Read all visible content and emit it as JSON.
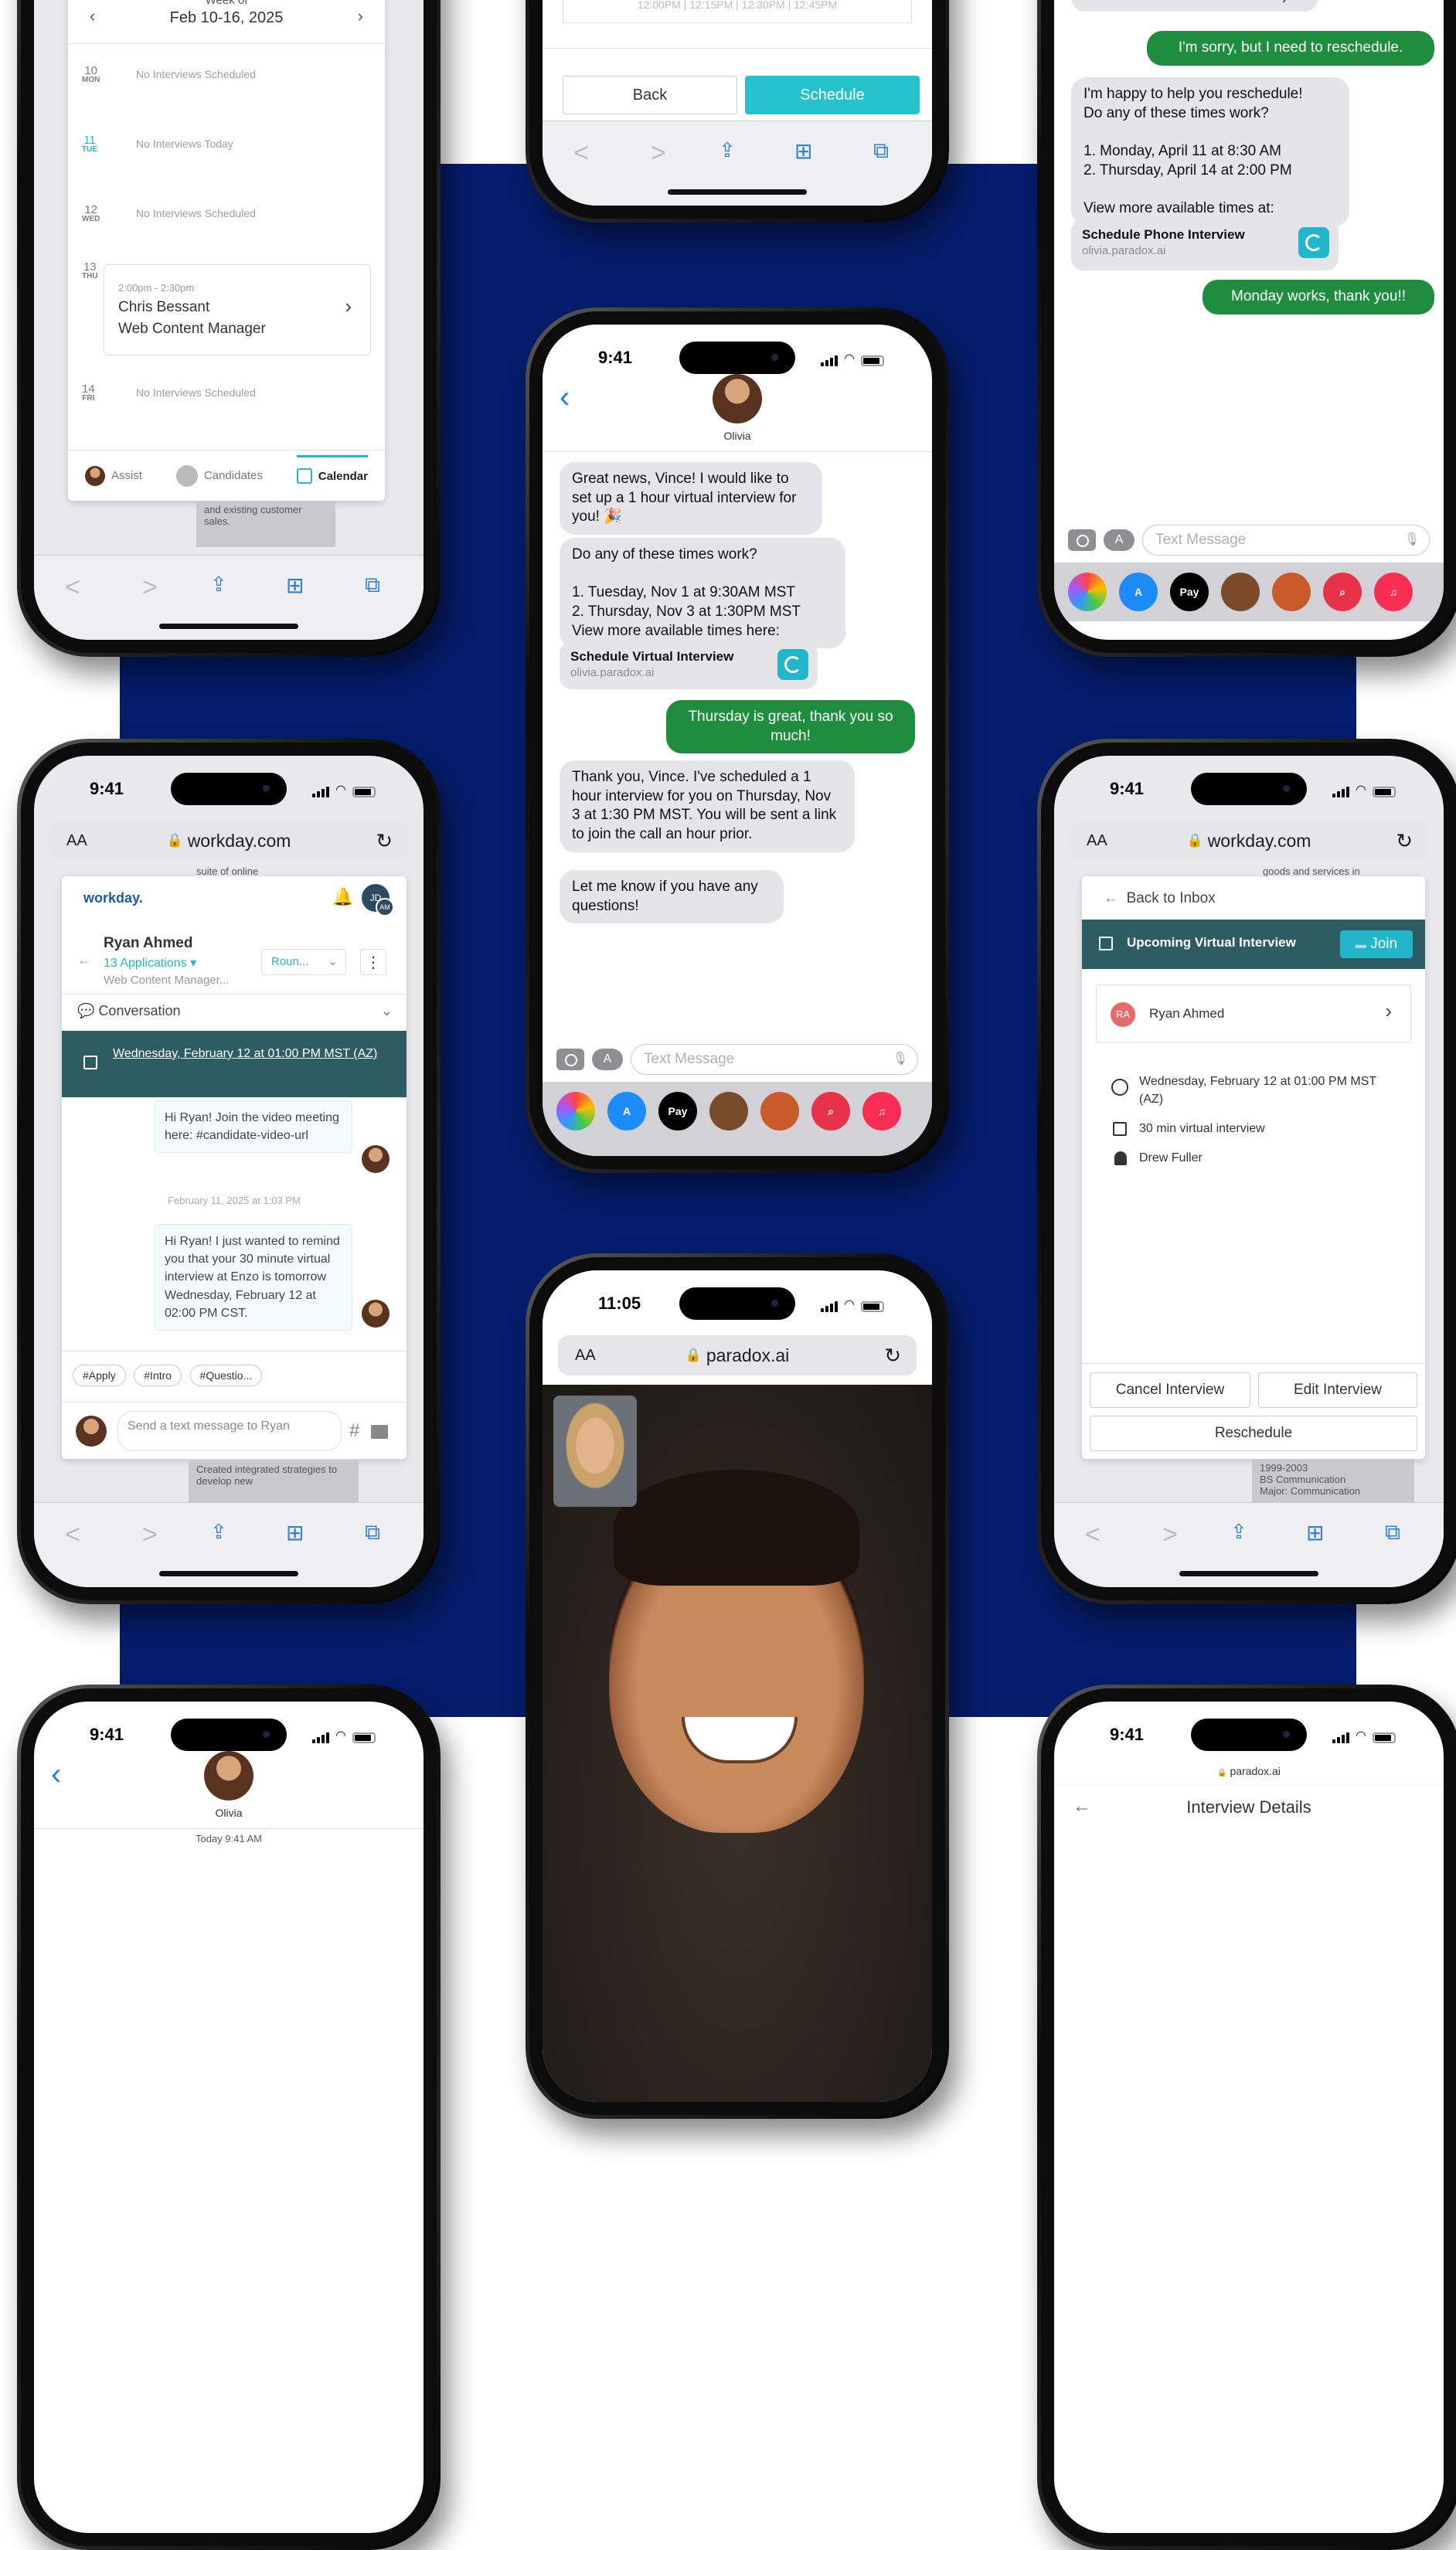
{
  "calendar_phone": {
    "week_label": "Week of",
    "week_range": "Feb 10-16, 2025",
    "days": [
      {
        "num": "10",
        "dow": "MON",
        "text": "No Interviews Scheduled"
      },
      {
        "num": "11",
        "dow": "TUE",
        "text": "No Interviews Today"
      },
      {
        "num": "12",
        "dow": "WED",
        "text": "No Interviews Scheduled"
      },
      {
        "num": "13",
        "dow": "THU",
        "text": ""
      },
      {
        "num": "14",
        "dow": "FRI",
        "text": "No Interviews Scheduled"
      }
    ],
    "event": {
      "time": "2:00pm - 2:30pm",
      "name": "Chris Bessant",
      "role": "Web Content Manager"
    },
    "tabs": [
      "Assist",
      "Candidates",
      "Calendar"
    ],
    "bg_text": "and existing customer sales."
  },
  "schedule_phone": {
    "slots": "12:00PM | 12:15PM | 12:30PM | 12:45PM",
    "back_label": "Back",
    "schedule_label": "Schedule"
  },
  "sms_top_phone": {
    "partial": "starts in one hour. Good luck! :)",
    "out1": "I'm sorry, but I need to reschedule.",
    "in1": "I'm happy to help you reschedule!\nDo any of these times work?\n\n1. Monday, April 11 at 8:30 AM\n2. Thursday, April 14 at 2:00 PM\n\nView more available times at:",
    "link_title": "Schedule Phone Interview",
    "link_url": "olivia.paradox.ai",
    "out2": "Monday works, thank you!!",
    "placeholder": "Text Message"
  },
  "olivia_phone": {
    "time": "9:41",
    "contact": "Olivia",
    "m1": "Great news, Vince! I would like to set up a 1 hour virtual interview for you! 🎉",
    "m2": "Do any of these times work?\n\n1. Tuesday, Nov 1 at 9:30AM MST\n2. Thursday, Nov 3 at 1:30PM MST\nView more available times here:",
    "link_title": "Schedule Virtual Interview",
    "link_url": "olivia.paradox.ai",
    "out": "Thursday is great, thank you so much!",
    "m3": "Thank you, Vince. I've scheduled a 1 hour interview for you on Thursday, Nov 3 at 1:30 PM MST. You will be sent a link to join the call an hour prior.",
    "m4": "Let me know if you have any questions!",
    "placeholder": "Text Message"
  },
  "workday_phone": {
    "time": "9:41",
    "url": "workday.com",
    "bg_text": "suite of online",
    "logo": "workday.",
    "avatar": "JD",
    "badge": "AM",
    "candidate": "Ryan Ahmed",
    "applications": "13 Applications",
    "role": "Web Content Manager...",
    "round": "Roun...",
    "conversation": "Conversation",
    "banner": "Wednesday, February 12 at 01:00 PM MST (AZ)",
    "msg1": "Hi Ryan! Join the video meeting here: #candidate-video-url",
    "divider": "February 11, 2025 at 1:03 PM",
    "msg2": "Hi Ryan! I just wanted to remind you that your 30 minute virtual interview at Enzo is tomorrow Wednesday, February 12 at 02:00 PM CST.",
    "chips": [
      "#Apply",
      "#Intro",
      "#Questio..."
    ],
    "composer": "Send a text message to Ryan",
    "bg_text2": "Created integrated strategies to develop new"
  },
  "inbox_phone": {
    "time": "9:41",
    "url": "workday.com",
    "bg_text": "goods and services in",
    "back": "Back to Inbox",
    "upcoming": "Upcoming Virtual Interview",
    "join": "Join",
    "initials": "RA",
    "candidate": "Ryan Ahmed",
    "when": "Wednesday, February 12 at 01:00 PM MST (AZ)",
    "duration": "30 min virtual interview",
    "interviewer": "Drew Fuller",
    "cancel": "Cancel Interview",
    "edit": "Edit Interview",
    "reschedule": "Reschedule",
    "bg_text2": "1999-2003\nBS Communication\nMajor: Communication"
  },
  "video_phone": {
    "time": "11:05",
    "url": "paradox.ai"
  },
  "bottom_left_phone": {
    "time": "9:41",
    "contact": "Olivia",
    "today": "Today 9:41 AM"
  },
  "bottom_right_phone": {
    "time": "9:41",
    "url": "paradox.ai",
    "title": "Interview Details"
  },
  "apps": [
    "Photos",
    "App Store",
    "Pay",
    "Memoji",
    "Memoji",
    "Search",
    "Music"
  ],
  "colors": {
    "navy": "#051d6b",
    "imessage_green": "#1e8e3e",
    "teal": "#21b6c9",
    "workday_banner": "#2e5c63"
  }
}
